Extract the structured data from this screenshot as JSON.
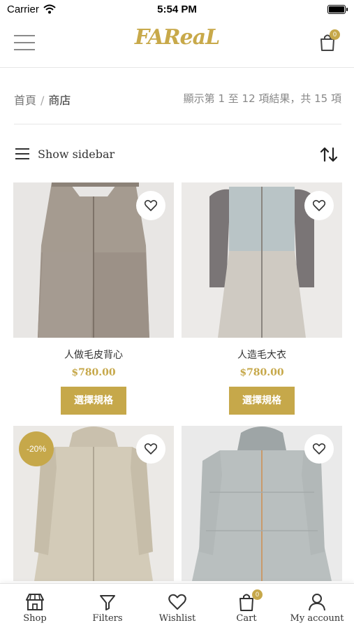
{
  "status_bar": {
    "carrier": "Carrier",
    "time": "5:54 PM"
  },
  "header": {
    "logo": "FAReaL",
    "cart_count": "0"
  },
  "breadcrumb": {
    "home": "首頁",
    "separator": "/",
    "current": "商店"
  },
  "result_count": "顯示第 1 至 12 項結果，共 15 項",
  "toolbar": {
    "sidebar_label": "Show sidebar"
  },
  "products": [
    {
      "name": "人做毛皮背心",
      "price": "$780.00",
      "button": "選擇規格",
      "sale": ""
    },
    {
      "name": "人造毛大衣",
      "price": "$780.00",
      "button": "選擇規格",
      "sale": ""
    },
    {
      "name": "",
      "price": "",
      "button": "",
      "sale": "-20%"
    },
    {
      "name": "",
      "price": "",
      "button": "",
      "sale": ""
    }
  ],
  "tabbar": {
    "items": [
      {
        "label": "Shop",
        "icon": "shop-icon"
      },
      {
        "label": "Filters",
        "icon": "filter-icon"
      },
      {
        "label": "Wishlist",
        "icon": "heart-icon"
      },
      {
        "label": "Cart",
        "icon": "cart-icon"
      },
      {
        "label": "My account",
        "icon": "user-icon"
      }
    ],
    "cart_count": "0"
  },
  "colors": {
    "accent": "#c6a84a",
    "text": "#333333",
    "muted": "#888888"
  }
}
